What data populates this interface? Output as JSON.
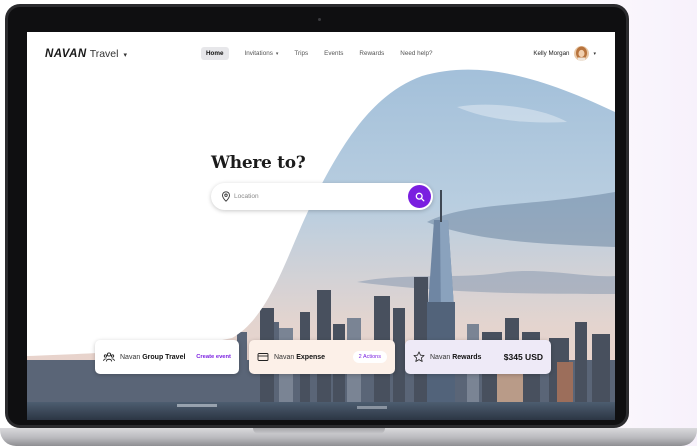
{
  "brand": {
    "logo_text": "NAVAN",
    "product": "Travel",
    "caret": "▾"
  },
  "nav": {
    "items": [
      {
        "label": "Home"
      },
      {
        "label": "Invitations",
        "caret": "▾"
      },
      {
        "label": "Trips"
      },
      {
        "label": "Events"
      },
      {
        "label": "Rewards"
      },
      {
        "label": "Need help?"
      }
    ]
  },
  "user": {
    "name": "Kelly Morgan",
    "caret": "▾"
  },
  "hero": {
    "headline": "Where to?"
  },
  "search": {
    "placeholder": "Location",
    "value": ""
  },
  "cards": [
    {
      "icon": "group-people-icon",
      "brand": "Navan",
      "product": "Group Travel",
      "action": "Create event"
    },
    {
      "icon": "card-icon",
      "brand": "Navan",
      "product": "Expense",
      "action": "2 Actions"
    },
    {
      "icon": "star-icon",
      "brand": "Navan",
      "product": "Rewards",
      "value": "$345 USD"
    }
  ],
  "colors": {
    "accent": "#7a1fe0",
    "sky": "#a9c4dc",
    "laptop": "#2b2b2e"
  }
}
